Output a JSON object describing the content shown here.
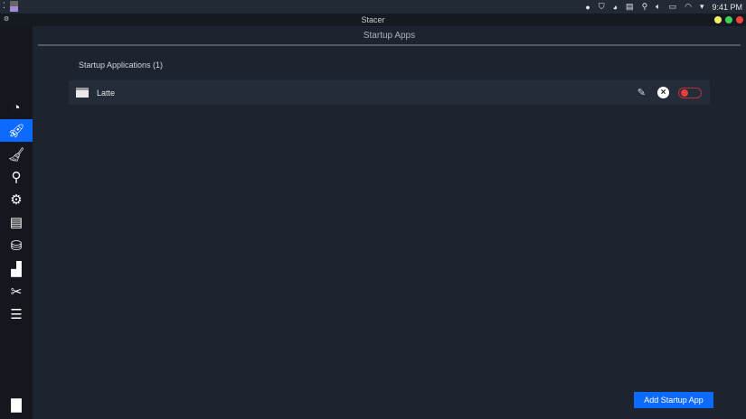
{
  "system_bar": {
    "time": "9:41 PM"
  },
  "window": {
    "title": "Stacer"
  },
  "page": {
    "title": "Startup Apps",
    "section_label": "Startup Applications (1)"
  },
  "apps": [
    {
      "name": "Latte",
      "enabled": false
    }
  ],
  "buttons": {
    "add": "Add Startup App"
  },
  "colors": {
    "accent": "#0d6aff",
    "toggle_off": "#ef3b3b"
  }
}
